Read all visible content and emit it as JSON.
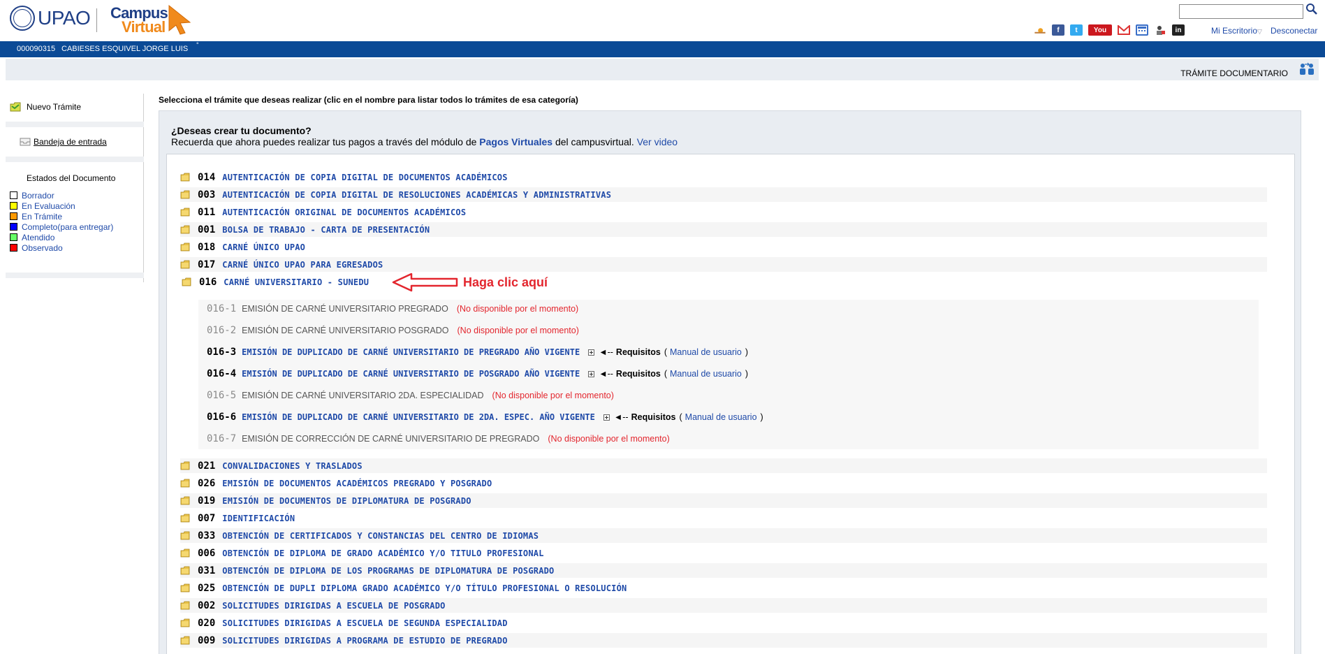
{
  "header": {
    "logo_text": "UPAO",
    "campus_line1": "Campus",
    "campus_line2": "Virtual",
    "search_placeholder": "",
    "nav_desk": "Mi Escritorio",
    "nav_desk_arrow": "▽",
    "nav_logout": "Desconectar",
    "social_youtube": "You",
    "social_linkedin": "in"
  },
  "userbar": {
    "code": "000090315",
    "name": "CABIESES ESQUIVEL JORGE LUIS",
    "dot": "°"
  },
  "module": {
    "title": "TRÁMITE DOCUMENTARIO"
  },
  "sidebar": {
    "new_label": "Nuevo Trámite",
    "inbox_label": "Bandeja de entrada",
    "states_title": "Estados del Documento",
    "states": [
      {
        "label": "Borrador",
        "color": "#ffffff"
      },
      {
        "label": "En Evaluación",
        "color": "#ffff00"
      },
      {
        "label": "En Trámite",
        "color": "#ff9900"
      },
      {
        "label": "Completo(para entregar)",
        "color": "#0000ff"
      },
      {
        "label": "Atendido",
        "color": "#66ff66"
      },
      {
        "label": "Observado",
        "color": "#ff0000"
      }
    ]
  },
  "main": {
    "instruction": "Selecciona el trámite que deseas realizar (clic en el nombre para listar todos lo trámites de esa categoría)",
    "question": "¿Deseas crear tu documento?",
    "recuerda_pre": "Recuerda que ahora puedes realizar tus pagos a través del módulo de ",
    "recuerda_link": "Pagos Virtuales",
    "recuerda_mid": " del campusvirtual. ",
    "recuerda_video": "Ver video",
    "callout": "Haga clic aquí",
    "categories_top": [
      {
        "code": "014",
        "name": "AUTENTICACIÓN DE COPIA DIGITAL DE DOCUMENTOS ACADÉMICOS"
      },
      {
        "code": "003",
        "name": "AUTENTICACIÓN DE COPIA DIGITAL DE RESOLUCIONES ACADÉMICAS Y ADMINISTRATIVAS"
      },
      {
        "code": "011",
        "name": "AUTENTICACIÓN ORIGINAL DE DOCUMENTOS ACADÉMICOS"
      },
      {
        "code": "001",
        "name": "BOLSA DE TRABAJO - CARTA DE PRESENTACIÓN"
      },
      {
        "code": "018",
        "name": "CARNÉ ÚNICO UPAO"
      },
      {
        "code": "017",
        "name": "CARNÉ ÚNICO UPAO PARA EGRESADOS"
      },
      {
        "code": "016",
        "name": "CARNÉ UNIVERSITARIO - SUNEDU"
      }
    ],
    "subitems": [
      {
        "code": "016-1",
        "name": "EMISIÓN DE CARNÉ UNIVERSITARIO PREGRADO",
        "na": "(No disponible por el momento)"
      },
      {
        "code": "016-2",
        "name": "EMISIÓN DE CARNÉ UNIVERSITARIO POSGRADO",
        "na": "(No disponible por el momento)"
      },
      {
        "code": "016-3",
        "name": "EMISIÓN DE DUPLICADO DE CARNÉ UNIVERSITARIO DE PREGRADO AÑO VIGENTE",
        "arrow": "◄--",
        "req": "Requisitos",
        "manual": "Manual de usuario",
        "p_open": "(",
        "p_close": ")"
      },
      {
        "code": "016-4",
        "name": "EMISIÓN DE DUPLICADO DE CARNÉ UNIVERSITARIO DE POSGRADO AÑO VIGENTE",
        "arrow": "◄--",
        "req": "Requisitos",
        "manual": "Manual de usuario",
        "p_open": "(",
        "p_close": ")"
      },
      {
        "code": "016-5",
        "name": "EMISIÓN DE CARNÉ UNIVERSITARIO 2DA. ESPECIALIDAD",
        "na": "(No disponible por el momento)"
      },
      {
        "code": "016-6",
        "name": "EMISIÓN DE DUPLICADO DE CARNÉ UNIVERSITARIO DE 2DA. ESPEC. AÑO VIGENTE",
        "arrow": "◄--",
        "req": "Requisitos",
        "manual": "Manual de usuario",
        "p_open": "(",
        "p_close": ")"
      },
      {
        "code": "016-7",
        "name": "EMISIÓN DE CORRECCIÓN DE CARNÉ UNIVERSITARIO DE PREGRADO",
        "na": "(No disponible por el momento)"
      }
    ],
    "categories_bottom": [
      {
        "code": "021",
        "name": "CONVALIDACIONES Y TRASLADOS"
      },
      {
        "code": "026",
        "name": "EMISIÓN DE DOCUMENTOS ACADÉMICOS PREGRADO Y POSGRADO"
      },
      {
        "code": "019",
        "name": "EMISIÓN DE DOCUMENTOS DE DIPLOMATURA DE POSGRADO"
      },
      {
        "code": "007",
        "name": "IDENTIFICACIÓN"
      },
      {
        "code": "033",
        "name": "OBTENCIÓN DE CERTIFICADOS Y CONSTANCIAS DEL CENTRO DE IDIOMAS"
      },
      {
        "code": "006",
        "name": "OBTENCIÓN DE DIPLOMA DE GRADO ACADÉMICO Y/O TITULO PROFESIONAL"
      },
      {
        "code": "031",
        "name": "OBTENCIÓN DE DIPLOMA DE LOS PROGRAMAS DE DIPLOMATURA DE POSGRADO"
      },
      {
        "code": "025",
        "name": "OBTENCIÓN DE DUPLI DIPLOMA GRADO ACADÉMICO Y/O TÍTULO PROFESIONAL O RESOLUCIÓN"
      },
      {
        "code": "002",
        "name": "SOLICITUDES DIRIGIDAS A ESCUELA DE POSGRADO"
      },
      {
        "code": "020",
        "name": "SOLICITUDES DIRIGIDAS A ESCUELA DE SEGUNDA ESPECIALIDAD"
      },
      {
        "code": "009",
        "name": "SOLICITUDES DIRIGIDAS A PROGRAMA DE ESTUDIO DE PREGRADO"
      }
    ]
  }
}
